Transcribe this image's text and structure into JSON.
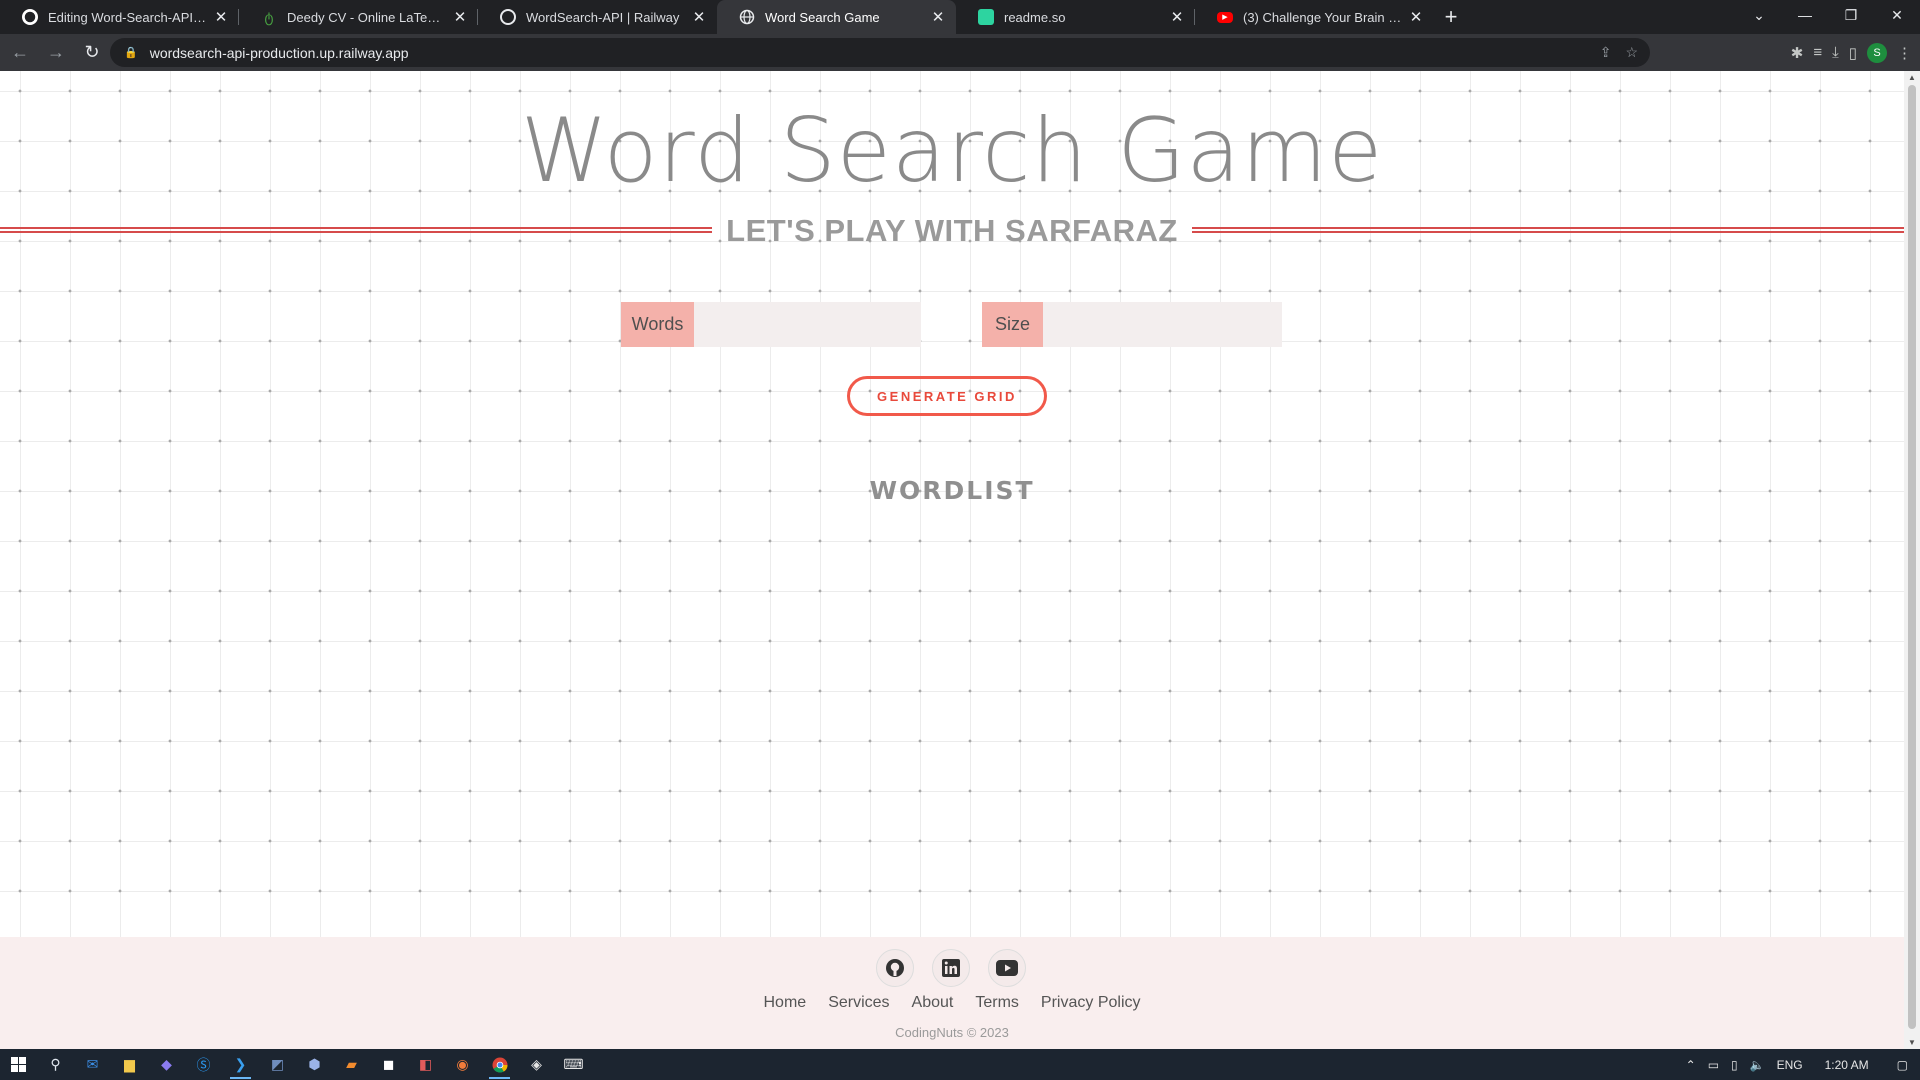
{
  "browser": {
    "tabs": [
      {
        "title": "Editing Word-Search-API/README",
        "favicon": "github-icon",
        "active": false
      },
      {
        "title": "Deedy CV - Online LaTeX Editor O",
        "favicon": "overleaf-icon",
        "active": false
      },
      {
        "title": "WordSearch-API | Railway",
        "favicon": "railway-icon",
        "active": false
      },
      {
        "title": "Word Search Game",
        "favicon": "globe-icon",
        "active": true
      },
      {
        "title": "readme.so",
        "favicon": "readme-icon",
        "active": false
      },
      {
        "title": "(3) Challenge Your Brain with My",
        "favicon": "youtube-icon",
        "active": false
      }
    ],
    "url": "wordsearch-api-production.up.railway.app",
    "profile_initial": "S"
  },
  "page": {
    "title": "Word Search Game",
    "subtitle": "LET'S PLAY WITH SARFARAZ",
    "words_label": "Words",
    "words_value": "",
    "size_label": "Size",
    "size_value": "",
    "generate_button": "GENERATE GRID",
    "wordlist_heading": "WORDLIST",
    "accent_color": "#f1594a",
    "label_bg": "#f4b1aa"
  },
  "footer": {
    "social": [
      "github-icon",
      "linkedin-icon",
      "youtube-icon"
    ],
    "links": [
      "Home",
      "Services",
      "About",
      "Terms",
      "Privacy Policy"
    ],
    "copyright": "CodingNuts © 2023"
  },
  "taskbar": {
    "language": "ENG",
    "time": "1:20 AM"
  }
}
